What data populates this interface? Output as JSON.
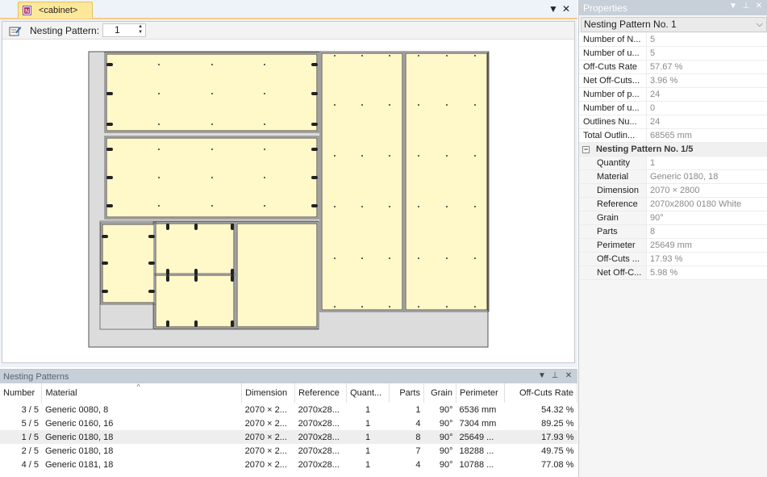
{
  "document": {
    "tab_title": "<cabinet>",
    "toolbar": {
      "pattern_label": "Nesting Pattern:",
      "pattern_value": "1"
    }
  },
  "bottom_panel": {
    "title": "Nesting Patterns",
    "columns": [
      "Number",
      "Material",
      "Dimension",
      "Reference",
      "Quant...",
      "Parts",
      "Grain",
      "Perimeter",
      "Off-Cuts Rate"
    ],
    "rows": [
      {
        "number": "3 / 5",
        "material": "Generic 0080, 8",
        "dimension": "2070 × 2...",
        "reference": "2070x28...",
        "quantity": "1",
        "parts": "1",
        "grain": "90°",
        "perimeter": "6536 mm",
        "offcuts": "54.32 %"
      },
      {
        "number": "5 / 5",
        "material": "Generic 0160, 16",
        "dimension": "2070 × 2...",
        "reference": "2070x28...",
        "quantity": "1",
        "parts": "4",
        "grain": "90°",
        "perimeter": "7304 mm",
        "offcuts": "89.25 %"
      },
      {
        "number": "1 / 5",
        "material": "Generic 0180, 18",
        "dimension": "2070 × 2...",
        "reference": "2070x28...",
        "quantity": "1",
        "parts": "8",
        "grain": "90°",
        "perimeter": "25649 ...",
        "offcuts": "17.93 %"
      },
      {
        "number": "2 / 5",
        "material": "Generic 0180, 18",
        "dimension": "2070 × 2...",
        "reference": "2070x28...",
        "quantity": "1",
        "parts": "7",
        "grain": "90°",
        "perimeter": "18288 ...",
        "offcuts": "49.75 %"
      },
      {
        "number": "4 / 5",
        "material": "Generic 0181, 18",
        "dimension": "2070 × 2...",
        "reference": "2070x28...",
        "quantity": "1",
        "parts": "4",
        "grain": "90°",
        "perimeter": "10788 ...",
        "offcuts": "77.08 %"
      }
    ],
    "selected_row": 2
  },
  "properties": {
    "title": "Properties",
    "selector": "Nesting Pattern No. 1",
    "rows": [
      {
        "name": "Number of N...",
        "value": "5"
      },
      {
        "name": "Number of u...",
        "value": "5"
      },
      {
        "name": "Off-Cuts Rate",
        "value": "57.67 %"
      },
      {
        "name": "Net Off-Cuts...",
        "value": "3.96 %"
      },
      {
        "name": "Number of p...",
        "value": "24"
      },
      {
        "name": "Number of u...",
        "value": "0"
      },
      {
        "name": "Outlines Nu...",
        "value": "24"
      },
      {
        "name": "Total Outlin...",
        "value": "68565 mm"
      }
    ],
    "group": {
      "title": "Nesting Pattern No. 1/5",
      "toggle": "−",
      "rows": [
        {
          "name": "Quantity",
          "value": "1"
        },
        {
          "name": "Material",
          "value": "Generic 0180, 18"
        },
        {
          "name": "Dimension",
          "value": "2070 × 2800"
        },
        {
          "name": "Reference",
          "value": "2070x2800 0180 White"
        },
        {
          "name": "Grain",
          "value": "90°"
        },
        {
          "name": "Parts",
          "value": "8"
        },
        {
          "name": "Perimeter",
          "value": "25649 mm"
        },
        {
          "name": "Off-Cuts ...",
          "value": "17.93 %"
        },
        {
          "name": "Net Off-C...",
          "value": "5.98 %"
        }
      ]
    }
  },
  "colors": {
    "part_fill": "#fff8c9",
    "sheet_fill": "#dcdcdc",
    "accent_tab": "#fde89a",
    "panel_header": "#c7cfd9"
  },
  "icons": [
    "nesting-doc-icon",
    "edit-pattern-icon",
    "dropdown-arrow-icon",
    "close-icon",
    "pin-icon",
    "sort-arrow-icon"
  ]
}
